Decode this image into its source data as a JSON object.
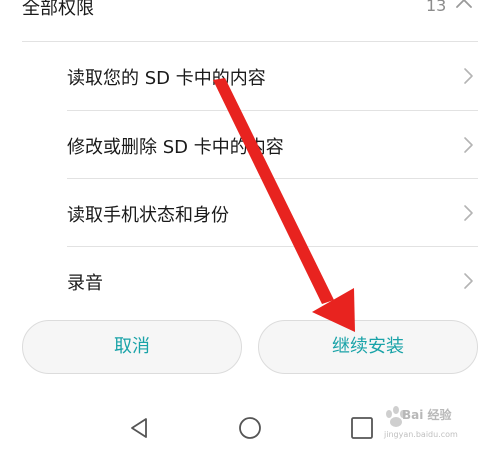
{
  "header": {
    "title": "全部权限",
    "count": "13",
    "chevron_icon": "chevron-up-icon"
  },
  "permissions": [
    {
      "label": "读取您的 SD 卡中的内容",
      "icon": "chevron-right-icon"
    },
    {
      "label": "修改或删除 SD 卡中的内容",
      "icon": "chevron-right-icon"
    },
    {
      "label": "读取手机状态和身份",
      "icon": "chevron-right-icon"
    },
    {
      "label": "录音",
      "icon": "chevron-right-icon"
    }
  ],
  "buttons": {
    "cancel_label": "取消",
    "install_label": "继续安装"
  },
  "navbar": {
    "back_icon": "back-triangle-icon",
    "home_icon": "home-circle-icon",
    "recents_icon": "recents-square-icon"
  },
  "watermark": {
    "text": "Bai 经验",
    "sub": "jingyan.baidu.com"
  },
  "colors": {
    "accent": "#1aa3a8",
    "annotation_arrow": "#e8231f",
    "text_primary": "#1a1a1a",
    "text_secondary": "#8c8c8c"
  }
}
